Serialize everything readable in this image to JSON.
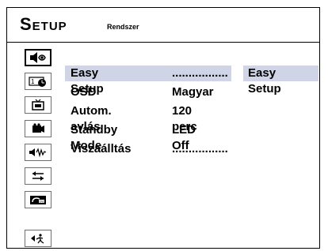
{
  "header": {
    "title": "Setup",
    "subtitle": "Rendszer"
  },
  "sidebar": {
    "icons": [
      "speaker-eye-icon",
      "clock-icon",
      "tv-icon",
      "camera-icon",
      "audio-wave-icon",
      "arrows-icon",
      "dvd-icon",
      "return-icon"
    ]
  },
  "menu": {
    "rows": [
      {
        "label": "Easy Setup",
        "value": "................."
      },
      {
        "label": "OSD",
        "value": "Magyar"
      },
      {
        "label": "Autom. avlás",
        "value": "120 perc"
      },
      {
        "label": "Standby Mode",
        "value": "LED Off"
      },
      {
        "label": "Viszaálltás",
        "value": "................."
      }
    ],
    "right_panel_value": "Easy Setup"
  },
  "colors": {
    "selection_bg": "#cfd5e6",
    "border": "#000000"
  }
}
